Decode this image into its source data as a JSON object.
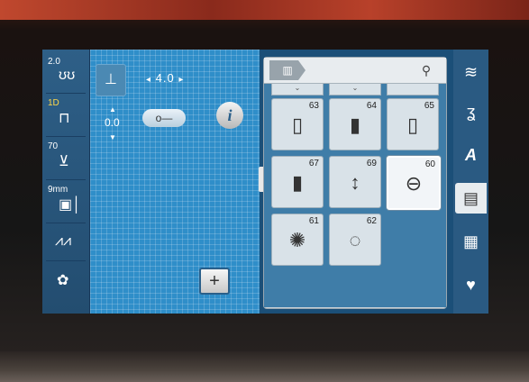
{
  "left_tools": [
    {
      "value": "2.0",
      "icon": "stitch-length-icon"
    },
    {
      "value": "1D",
      "icon": "presser-foot-icon"
    },
    {
      "value": "70",
      "icon": "thread-tension-icon"
    },
    {
      "value": "9mm",
      "icon": "needle-plate-icon"
    },
    {
      "value": "",
      "icon": "zigzag-pattern-icon"
    },
    {
      "value": "",
      "icon": "bobbin-icon"
    }
  ],
  "center": {
    "width_value": "4.0",
    "length_value": "0.0",
    "info_label": "i",
    "plus_label": "+"
  },
  "panel": {
    "category_icon": "buttonhole-category-icon",
    "search_icon": "search-icon",
    "cells": [
      {
        "num": "63",
        "glyph": "▯"
      },
      {
        "num": "64",
        "glyph": "▮"
      },
      {
        "num": "65",
        "glyph": "▯"
      },
      {
        "num": "67",
        "glyph": "▮"
      },
      {
        "num": "69",
        "glyph": "↕"
      },
      {
        "num": "60",
        "glyph": "⊖"
      },
      {
        "num": "61",
        "glyph": "✺"
      },
      {
        "num": "62",
        "glyph": "◌"
      }
    ]
  },
  "right_categories": [
    {
      "name": "practical-stitches-icon",
      "glyph": "≋"
    },
    {
      "name": "decorative-stitches-icon",
      "glyph": "ʓ"
    },
    {
      "name": "alphabets-icon",
      "glyph": "A"
    },
    {
      "name": "buttonholes-icon",
      "glyph": "▤",
      "active": true
    },
    {
      "name": "quilt-stitches-icon",
      "glyph": "▦"
    },
    {
      "name": "favorites-icon",
      "glyph": "♥"
    }
  ]
}
